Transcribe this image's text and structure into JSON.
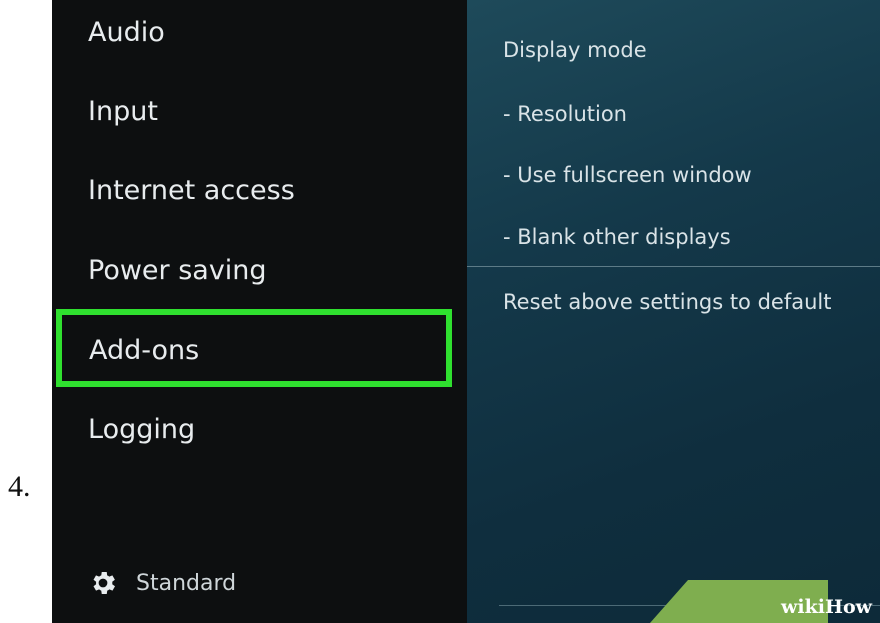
{
  "step": {
    "number": "4."
  },
  "sidebar": {
    "items": [
      {
        "label": "Audio"
      },
      {
        "label": "Input"
      },
      {
        "label": "Internet access"
      },
      {
        "label": "Power saving"
      },
      {
        "label": "Add-ons",
        "highlighted": true
      },
      {
        "label": "Logging"
      }
    ],
    "settings_level": {
      "label": "Standard",
      "icon": "gear-icon"
    }
  },
  "content": {
    "settings": [
      {
        "label": "Display mode"
      },
      {
        "label": "- Resolution"
      },
      {
        "label": "- Use fullscreen window"
      },
      {
        "label": "- Blank other displays"
      },
      {
        "label": "Reset above settings to default"
      }
    ]
  },
  "watermark": {
    "wiki": "wiki",
    "how": "How"
  },
  "colors": {
    "highlight_border": "#2fe02f",
    "sidebar_bg": "#0d0f10",
    "content_bg": "#14394a",
    "watermark_bg": "#7fae4f"
  }
}
